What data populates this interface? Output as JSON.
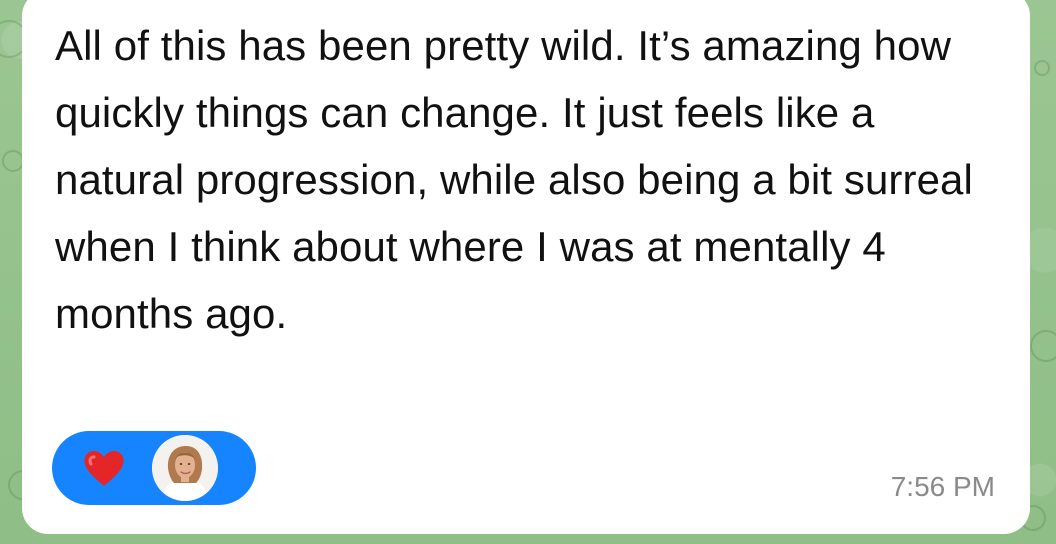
{
  "message": {
    "text": "All of this has been pretty wild. It’s amazing how quickly things can change. It just feels like a natural progression, while also being a bit surreal when I think about where I was at mentally 4 months ago.",
    "time": "7:56 PM"
  },
  "reaction": {
    "emoji": "heart-icon",
    "reactor": "avatar",
    "pill_color": "#1683FF",
    "heart_color": "#E52628"
  },
  "colors": {
    "wallpaper": "#97C28F",
    "bubble": "#FFFFFF",
    "text": "#111111",
    "timestamp": "#8A8A8A"
  }
}
